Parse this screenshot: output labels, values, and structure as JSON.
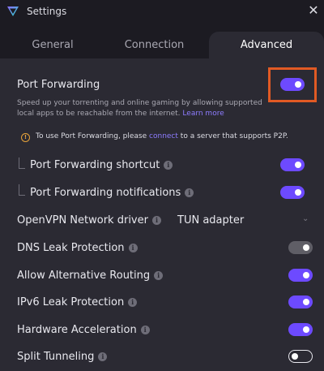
{
  "window": {
    "title": "Settings"
  },
  "tabs": [
    {
      "label": "General"
    },
    {
      "label": "Connection"
    },
    {
      "label": "Advanced"
    }
  ],
  "port_forwarding": {
    "label": "Port Forwarding",
    "enabled": true,
    "description": "Speed up your torrenting and online gaming by allowing supported local apps to be reachable from the internet.",
    "learn_more": "Learn more",
    "warning_prefix": "To use Port Forwarding, please",
    "warning_link": "connect",
    "warning_suffix": "to a server that supports P2P."
  },
  "settings": {
    "pf_shortcut": {
      "label": "Port Forwarding shortcut",
      "enabled": true
    },
    "pf_notifications": {
      "label": "Port Forwarding notifications",
      "enabled": true
    },
    "openvpn_driver": {
      "label": "OpenVPN Network driver",
      "value": "TUN adapter"
    },
    "dns_leak": {
      "label": "DNS Leak Protection",
      "enabled": true,
      "disabled": true
    },
    "alt_routing": {
      "label": "Allow Alternative Routing",
      "enabled": true
    },
    "ipv6_leak": {
      "label": "IPv6 Leak Protection",
      "enabled": true
    },
    "hw_accel": {
      "label": "Hardware Acceleration",
      "enabled": true
    },
    "split_tunneling": {
      "label": "Split Tunneling",
      "enabled": false
    }
  },
  "colors": {
    "accent": "#6d4aff",
    "highlight": "#e15a24",
    "background": "#1c1b22",
    "panel": "#2b2a33",
    "warning": "#e7a33a"
  }
}
